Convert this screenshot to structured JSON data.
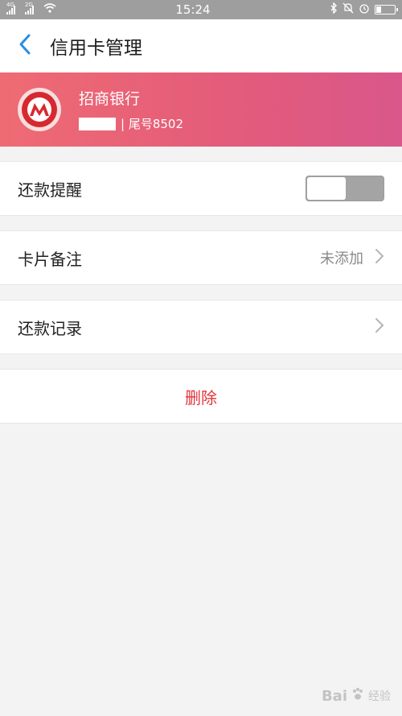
{
  "status_bar": {
    "time": "15:24",
    "signal1_label": "4G",
    "signal2_label": "2G"
  },
  "header": {
    "title": "信用卡管理",
    "back_icon": "chevron-left-icon"
  },
  "card": {
    "bank_name": "招商银行",
    "tail_label": "| 尾号8502",
    "gradient_colors": [
      "#ef6b73",
      "#d9578a"
    ]
  },
  "settings": {
    "reminder_label": "还款提醒",
    "reminder_on": false,
    "note_label": "卡片备注",
    "note_value": "未添加",
    "records_label": "还款记录",
    "delete_label": "删除"
  },
  "watermark": {
    "text": "Bai",
    "sub": "经验"
  },
  "colors": {
    "back_icon": "#2a8de0",
    "delete": "#e0343a"
  }
}
